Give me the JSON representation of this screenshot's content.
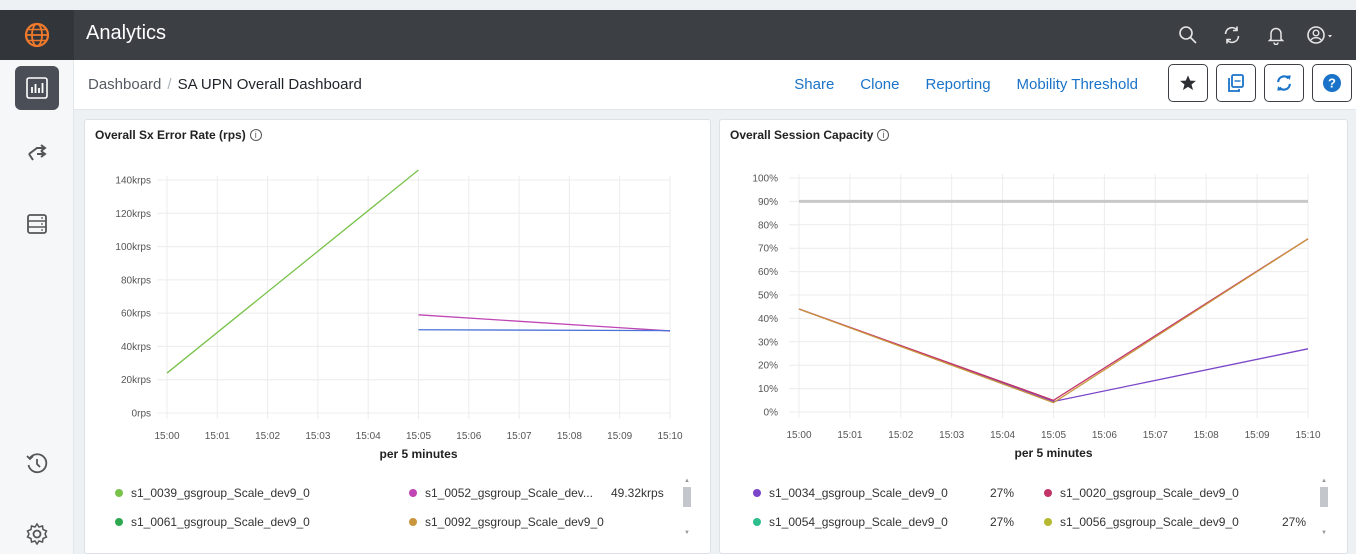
{
  "app": {
    "title": "Analytics"
  },
  "icons": {
    "logo": "globe-icon",
    "top": [
      "search-icon",
      "refresh-icon",
      "bell-icon",
      "user-icon"
    ],
    "sidebar": [
      "bar-chart-icon",
      "route-icon",
      "server-icon",
      "history-icon",
      "gear-icon"
    ],
    "actions": [
      "star-icon",
      "copy-icon",
      "refresh-icon",
      "help-icon"
    ]
  },
  "breadcrumb": {
    "root": "Dashboard",
    "separator": "/",
    "current": "SA UPN Overall Dashboard"
  },
  "links": [
    "Share",
    "Clone",
    "Reporting",
    "Mobility Threshold"
  ],
  "colors": {
    "accent": "#1a73c8",
    "topbar": "#3c3f44",
    "logo": "#f07a2b"
  },
  "panels": [
    {
      "title": "Overall Sx Error Rate (rps)",
      "info": "i",
      "xlabel": "per 5 minutes",
      "legend": [
        {
          "name": "s1_0039_gsgroup_Scale_dev9_0",
          "color": "#78c24a",
          "value": ""
        },
        {
          "name": "s1_0052_gsgroup_Scale_dev...",
          "color": "#c045b5",
          "value": "49.32krps"
        },
        {
          "name": "s1_0061_gsgroup_Scale_dev9_0",
          "color": "#2ea84f",
          "value": ""
        },
        {
          "name": "s1_0092_gsgroup_Scale_dev9_0",
          "color": "#c9953d",
          "value": ""
        }
      ]
    },
    {
      "title": "Overall Session Capacity",
      "info": "i",
      "xlabel": "per 5 minutes",
      "legend": [
        {
          "name": "s1_0034_gsgroup_Scale_dev9_0",
          "color": "#7a45c8",
          "value": "27%"
        },
        {
          "name": "s1_0020_gsgroup_Scale_dev9_0",
          "color": "#c2336a",
          "value": ""
        },
        {
          "name": "s1_0054_gsgroup_Scale_dev9_0",
          "color": "#2ebd8c",
          "value": "27%"
        },
        {
          "name": "s1_0056_gsgroup_Scale_dev9_0",
          "color": "#b5b830",
          "value": "27%"
        }
      ]
    }
  ],
  "chart_data": [
    {
      "type": "line",
      "title": "Overall Sx Error Rate (rps)",
      "xlabel": "per 5 minutes",
      "ylabel": "",
      "x": [
        "15:00",
        "15:01",
        "15:02",
        "15:03",
        "15:04",
        "15:05",
        "15:06",
        "15:07",
        "15:08",
        "15:09",
        "15:10"
      ],
      "ylim": [
        0,
        140000
      ],
      "yticks": [
        0,
        20000,
        40000,
        60000,
        80000,
        100000,
        120000,
        140000
      ],
      "ytick_labels": [
        "0rps",
        "20krps",
        "40krps",
        "60krps",
        "80krps",
        "100krps",
        "120krps",
        "140krps"
      ],
      "grid": true,
      "series": [
        {
          "name": "s1_0039_gsgroup_Scale_dev9_0",
          "color": "#78c24a",
          "points": [
            [
              "15:00",
              24000
            ],
            [
              "15:05",
              146000
            ]
          ]
        },
        {
          "name": "s1_0052_gsgroup_Scale_dev...",
          "color": "#c045b5",
          "points": [
            [
              "15:05",
              59000
            ],
            [
              "15:10",
              49320
            ]
          ]
        },
        {
          "name": "s1_0061_gsgroup_Scale_dev9_0",
          "color": "#4a72d8",
          "points": [
            [
              "15:05",
              50000
            ],
            [
              "15:10",
              49500
            ]
          ]
        }
      ]
    },
    {
      "type": "line",
      "title": "Overall Session Capacity",
      "xlabel": "per 5 minutes",
      "ylabel": "",
      "x": [
        "15:00",
        "15:01",
        "15:02",
        "15:03",
        "15:04",
        "15:05",
        "15:06",
        "15:07",
        "15:08",
        "15:09",
        "15:10"
      ],
      "ylim": [
        0,
        100
      ],
      "yticks": [
        0,
        10,
        20,
        30,
        40,
        50,
        60,
        70,
        80,
        90,
        100
      ],
      "ytick_labels": [
        "0%",
        "10%",
        "20%",
        "30%",
        "40%",
        "50%",
        "60%",
        "70%",
        "80%",
        "90%",
        "100%"
      ],
      "grid": true,
      "threshold": {
        "value": 90,
        "color": "#c8c8c8"
      },
      "series": [
        {
          "name": "s1_0034_gsgroup_Scale_dev9_0",
          "color": "#7a45c8",
          "points": [
            [
              "15:00",
              44
            ],
            [
              "15:05",
              4.5
            ],
            [
              "15:10",
              27
            ]
          ]
        },
        {
          "name": "s1_0020_gsgroup_Scale_dev9_0",
          "color": "#c2336a",
          "points": [
            [
              "15:00",
              44
            ],
            [
              "15:05",
              5
            ],
            [
              "15:10",
              74
            ]
          ]
        },
        {
          "name": "s1_0056_gsgroup_Scale_dev9_0",
          "color": "#c9953d",
          "points": [
            [
              "15:00",
              44
            ],
            [
              "15:05",
              4
            ],
            [
              "15:10",
              74
            ]
          ]
        }
      ]
    }
  ]
}
